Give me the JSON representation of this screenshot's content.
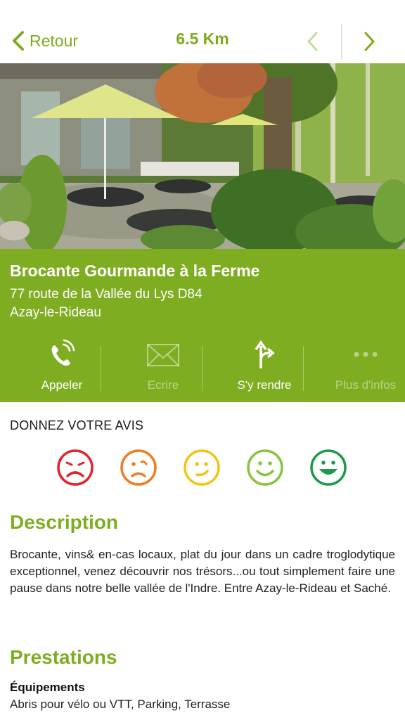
{
  "topbar": {
    "back_label": "Retour",
    "distance": "6.5 Km"
  },
  "poi": {
    "name": "Brocante Gourmande à la Ferme",
    "address_line1": "77 route de la Vallée du Lys D84",
    "address_line2": "Azay-le-Rideau"
  },
  "actions": [
    {
      "label": "Appeler",
      "icon": "phone-icon",
      "enabled": true
    },
    {
      "label": "Ecrire",
      "icon": "envelope-icon",
      "enabled": false
    },
    {
      "label": "S'y rendre",
      "icon": "directions-icon",
      "enabled": true
    },
    {
      "label": "Plus d'infos",
      "icon": "more-dots-icon",
      "enabled": false
    }
  ],
  "rating": {
    "title": "DONNEZ VOTRE AVIS",
    "options": [
      {
        "name": "very-sad-face-icon",
        "color": "#e3232b"
      },
      {
        "name": "sad-face-icon",
        "color": "#f07c23"
      },
      {
        "name": "neutral-face-icon",
        "color": "#f3c513"
      },
      {
        "name": "smile-face-icon",
        "color": "#88c43f"
      },
      {
        "name": "big-smile-face-icon",
        "color": "#1d9a4b"
      }
    ]
  },
  "description": {
    "title": "Description",
    "text": "Brocante, vins& en-cas locaux, plat du jour dans un cadre troglodytique exceptionnel, venez découvrir nos trésors...ou tout simplement faire une pause dans notre belle vallée de l'Indre. Entre Azay-le-Rideau et Saché."
  },
  "prestations": {
    "title": "Prestations",
    "equipements_label": "Équipements",
    "equipements_value": "Abris pour vélo ou VTT, Parking, Terrasse"
  },
  "colors": {
    "brand_green": "#7fad22",
    "text_dark": "#222222"
  }
}
